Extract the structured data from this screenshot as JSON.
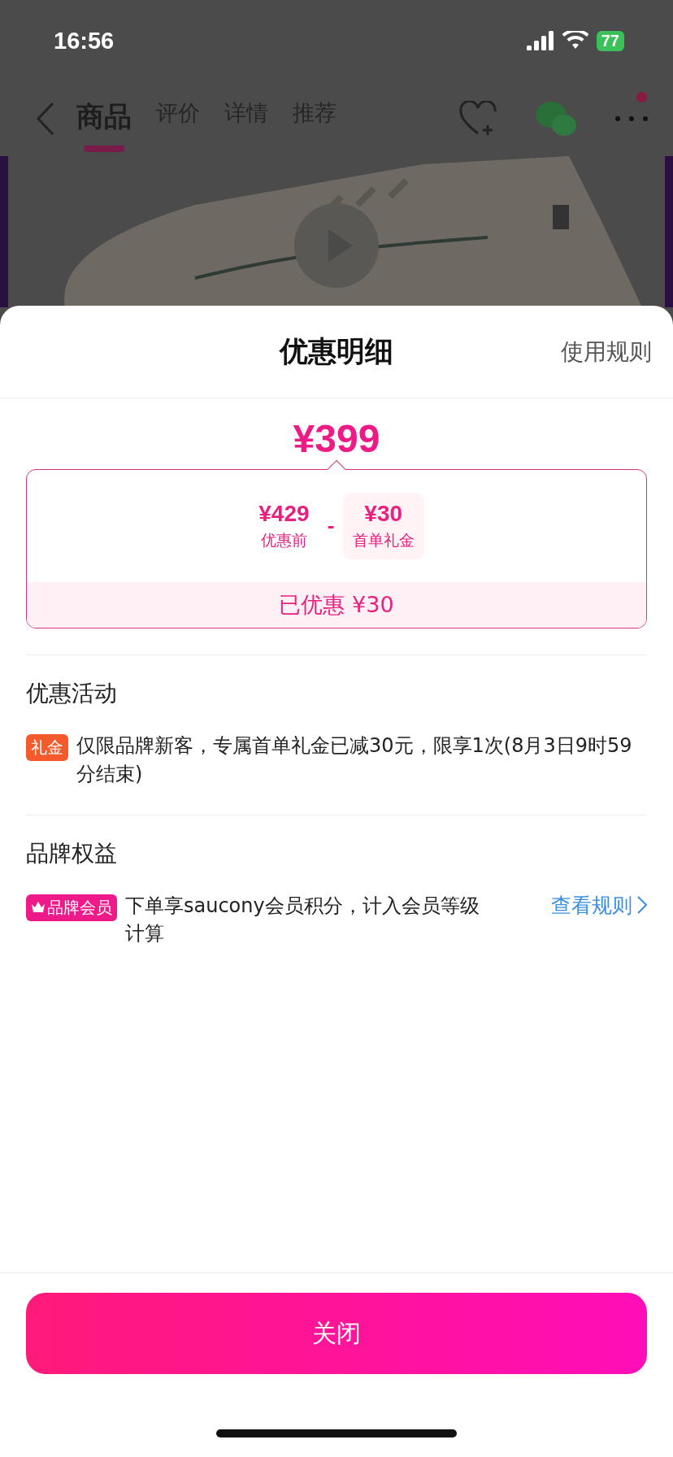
{
  "status_bar": {
    "time": "16:56",
    "battery": "77"
  },
  "nav": {
    "tabs": [
      {
        "label": "商品",
        "selected": true
      },
      {
        "label": "评价",
        "selected": false
      },
      {
        "label": "详情",
        "selected": false
      },
      {
        "label": "推荐",
        "selected": false
      }
    ],
    "notification_dot": true
  },
  "sheet": {
    "title": "优惠明细",
    "rules_link": "使用规则",
    "price": "¥399",
    "breakdown": {
      "original": {
        "amount": "¥429",
        "label": "优惠前"
      },
      "operator": "-",
      "discount": {
        "amount": "¥30",
        "label": "首单礼金"
      },
      "saved": "已优惠 ¥30"
    },
    "sections": [
      {
        "title": "优惠活动",
        "items": [
          {
            "kind": "gift",
            "tag": "礼金",
            "color": "#f55a2c",
            "text": "仅限品牌新客，专属首单礼金已减30元，限享1次(8月3日9时59分结束)"
          }
        ]
      },
      {
        "title": "品牌权益",
        "items": [
          {
            "kind": "member",
            "tag": "品牌会员",
            "color": "#ee1a8a",
            "text": "下单享saucony会员积分，计入会员等级计算",
            "link": "查看规则"
          }
        ]
      }
    ],
    "close_button": "关闭"
  }
}
